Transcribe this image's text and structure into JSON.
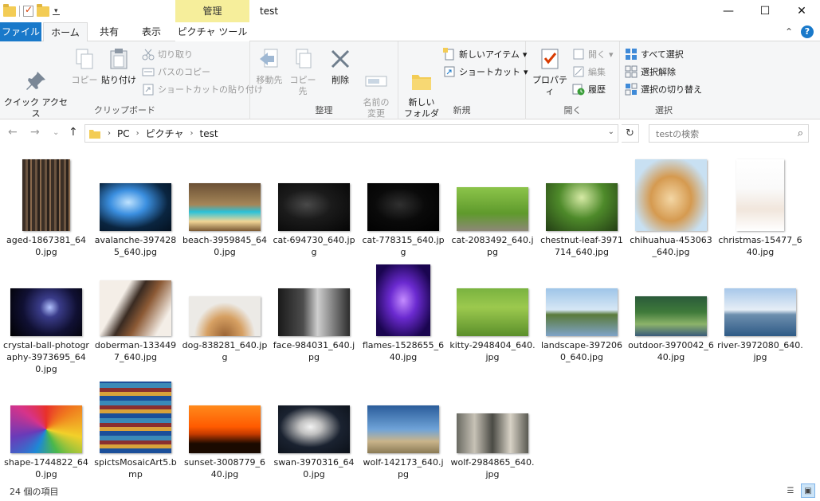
{
  "window": {
    "title": "test",
    "context_tab": "管理",
    "controls": [
      "—",
      "☐",
      "✕"
    ]
  },
  "tabs": {
    "file": "ファイル",
    "home": "ホーム",
    "share": "共有",
    "view": "表示",
    "picture_tools": "ピクチャ ツール"
  },
  "ribbon": {
    "clipboard": {
      "label": "クリップボード",
      "pin": "クイック アクセス\nにピン留めする",
      "copy": "コピー",
      "paste": "貼り付け",
      "cut": "切り取り",
      "copy_path": "パスのコピー",
      "paste_shortcut": "ショートカットの貼り付け"
    },
    "organize": {
      "label": "整理",
      "move_to": "移動先",
      "copy_to": "コピー先",
      "delete": "削除",
      "rename": "名前の\n変更"
    },
    "new": {
      "label": "新規",
      "new_folder": "新しい\nフォルダー",
      "new_item": "新しいアイテム",
      "shortcut": "ショートカット"
    },
    "open": {
      "label": "開く",
      "properties": "プロパティ",
      "open": "開く",
      "edit": "編集",
      "history": "履歴"
    },
    "select": {
      "label": "選択",
      "select_all": "すべて選択",
      "select_none": "選択解除",
      "invert": "選択の切り替え"
    }
  },
  "address": {
    "crumbs": [
      "PC",
      "ピクチャ",
      "test"
    ],
    "search_placeholder": "testの検索"
  },
  "files": [
    {
      "name": "aged-1867381_640.jpg",
      "style": "books"
    },
    {
      "name": "avalanche-3974285_640.jpg",
      "style": "avalanche"
    },
    {
      "name": "beach-3959845_640.jpg",
      "style": "beach"
    },
    {
      "name": "cat-694730_640.jpg",
      "style": "darkcat"
    },
    {
      "name": "cat-778315_640.jpg",
      "style": "blackcat"
    },
    {
      "name": "cat-2083492_640.jpg",
      "style": "greencat"
    },
    {
      "name": "chestnut-leaf-3971714_640.jpg",
      "style": "leaf"
    },
    {
      "name": "chihuahua-453063_640.jpg",
      "style": "chihuahua"
    },
    {
      "name": "christmas-15477_640.jpg",
      "style": "christmas"
    },
    {
      "name": "crystal-ball-photography-3973695_640.jpg",
      "style": "crystal"
    },
    {
      "name": "doberman-1334497_640.jpg",
      "style": "doberman"
    },
    {
      "name": "dog-838281_640.jpg",
      "style": "dog"
    },
    {
      "name": "face-984031_640.jpg",
      "style": "face"
    },
    {
      "name": "flames-1528655_640.jpg",
      "style": "flames"
    },
    {
      "name": "kitty-2948404_640.jpg",
      "style": "kitty"
    },
    {
      "name": "landscape-3972060_640.jpg",
      "style": "landscape"
    },
    {
      "name": "outdoor-3970042_640.jpg",
      "style": "outdoor"
    },
    {
      "name": "river-3972080_640.jpg",
      "style": "river"
    },
    {
      "name": "shape-1744822_640.jpg",
      "style": "pencils"
    },
    {
      "name": "spictsMosaicArt5.bmp",
      "style": "mosaic"
    },
    {
      "name": "sunset-3008779_640.jpg",
      "style": "sunset"
    },
    {
      "name": "swan-3970316_640.jpg",
      "style": "swan"
    },
    {
      "name": "wolf-142173_640.jpg",
      "style": "wolf"
    },
    {
      "name": "wolf-2984865_640.jpg",
      "style": "wolves"
    }
  ],
  "status": {
    "item_count": "24 個の項目"
  },
  "colors": {
    "accent": "#1979ca",
    "context_tab": "#f6ee9b",
    "ribbon_bg": "#f5f6f7"
  }
}
